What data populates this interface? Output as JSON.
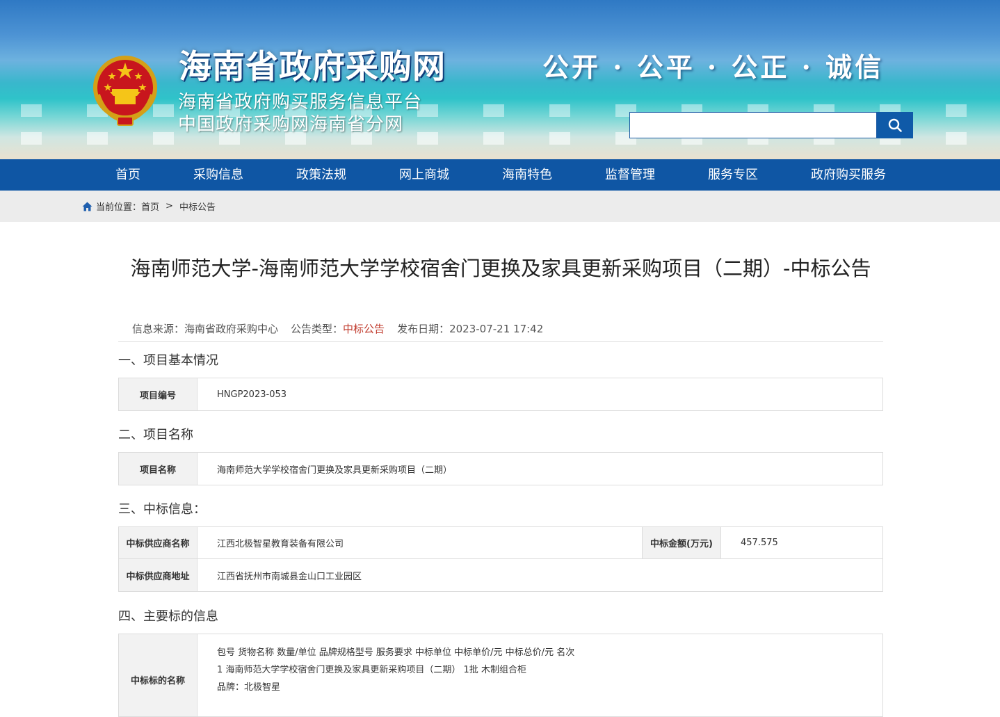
{
  "header": {
    "site_title": "海南省政府采购网",
    "subtitle_1": "海南省政府购买服务信息平台",
    "subtitle_2": "中国政府采购网海南省分网",
    "slogan": "公开 · 公平 · 公正 · 诚信",
    "search": {
      "value": "",
      "placeholder": ""
    },
    "search_icon": "search-icon",
    "emblem_icon": "national-emblem-icon"
  },
  "nav": {
    "items": [
      {
        "label": "首页"
      },
      {
        "label": "采购信息"
      },
      {
        "label": "政策法规"
      },
      {
        "label": "网上商城"
      },
      {
        "label": "海南特色"
      },
      {
        "label": "监督管理"
      },
      {
        "label": "服务专区"
      },
      {
        "label": "政府购买服务"
      }
    ]
  },
  "breadcrumb": {
    "icon": "home-icon",
    "prefix": "当前位置：",
    "items": [
      "首页",
      "中标公告"
    ],
    "separator": ">"
  },
  "article": {
    "title": "海南师范大学-海南师范大学学校宿舍门更换及家具更新采购项目（二期）-中标公告",
    "meta": {
      "source_label": "信息来源：",
      "source": "海南省政府采购中心",
      "type_label": "公告类型：",
      "type": "中标公告",
      "date_label": "发布日期：",
      "date": "2023-07-21 17:42"
    },
    "sections": {
      "s1": "一、项目基本情况",
      "s2": "二、项目名称",
      "s3": "三、中标信息：",
      "s4": "四、主要标的信息"
    },
    "project_no": {
      "label": "项目编号",
      "value": "HNGP2023-053"
    },
    "project_name": {
      "label": "项目名称",
      "value": "海南师范大学学校宿舍门更换及家具更新采购项目（二期）"
    },
    "winner": {
      "supplier_label": "中标供应商名称",
      "supplier": "江西北极智星教育装备有限公司",
      "amount_label": "中标金额(万元)",
      "amount": "457.575",
      "address_label": "中标供应商地址",
      "address": "江西省抚州市南城县金山口工业园区"
    },
    "subject": {
      "label": "中标标的名称",
      "lines": [
        "包号 货物名称 数量/单位 品牌规格型号 服务要求 中标单位 中标单价/元 中标总价/元 名次",
        "1 海南师范大学学校宿舍门更换及家具更新采购项目（二期） 1批 木制组合柜",
        "品牌：北极智星"
      ]
    }
  },
  "colors": {
    "nav_bg": "#0f56a4",
    "crumb_bg": "#ececec",
    "accent_red": "#c0392b",
    "table_header_bg": "#f2f2f2"
  }
}
